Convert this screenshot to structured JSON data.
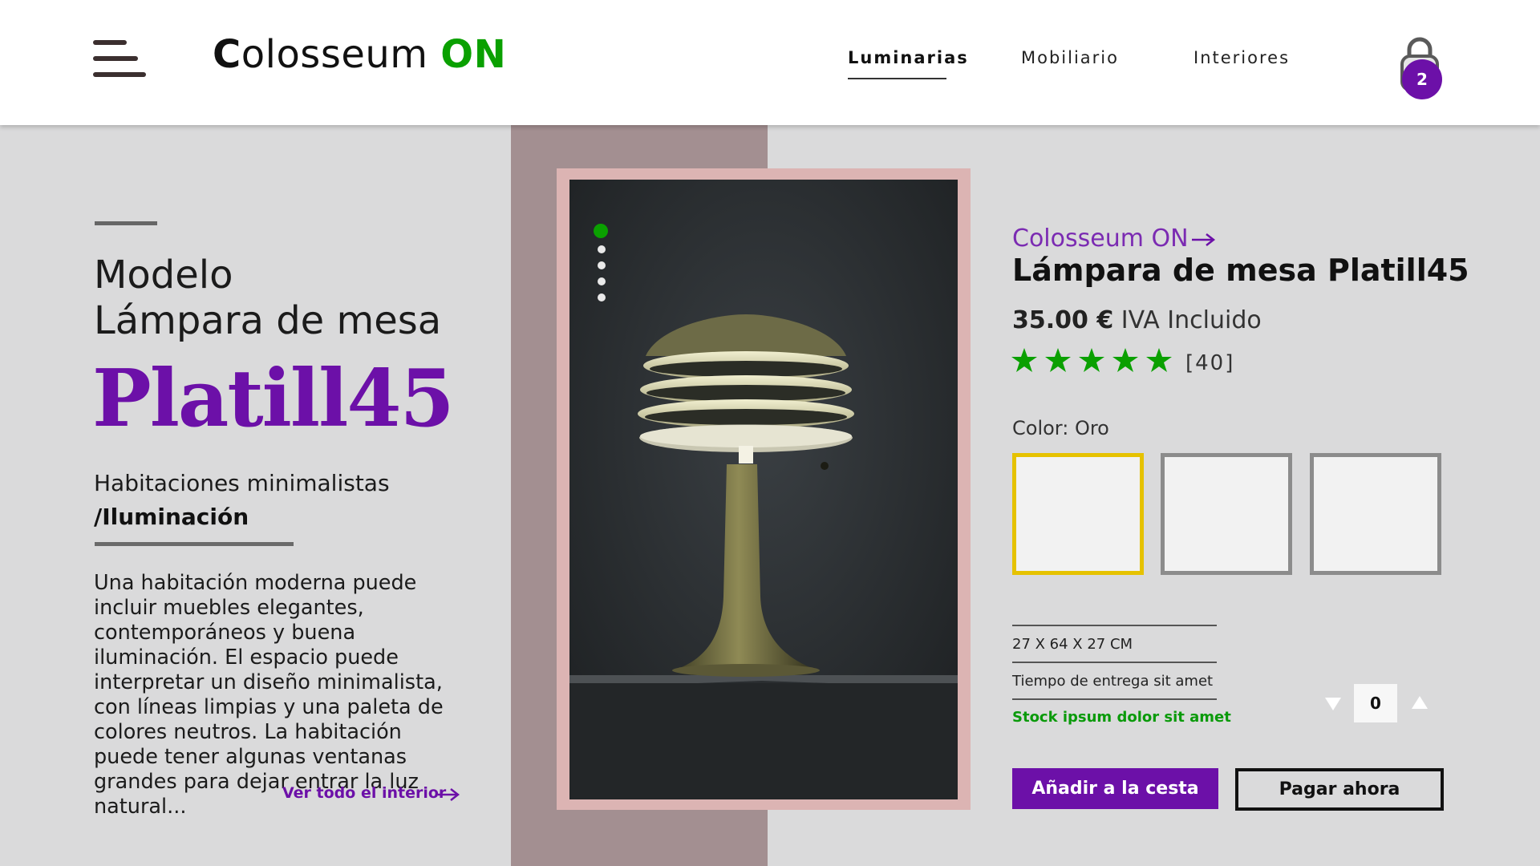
{
  "header": {
    "logo_initial": "C",
    "logo_text": "olosseum",
    "logo_accent": "ON",
    "nav": [
      {
        "label": "Luminarias",
        "active": true
      },
      {
        "label": "Mobiliario",
        "active": false
      },
      {
        "label": "Interiores",
        "active": false
      }
    ],
    "cart_count": "2"
  },
  "hero": {
    "model_line1": "Modelo",
    "model_line2": "Lámpara de mesa",
    "product_name": "Platill45",
    "subtitle": "Habitaciones minimalistas",
    "category": "/Iluminación",
    "description": "Una habitación moderna puede incluir muebles elegantes, contemporáneos y buena iluminación. El espacio puede interpretar un diseño minimalista, con líneas limpias y una paleta de colores neutros. La habitación puede tener algunas ventanas grandes para dejar entrar la luz natural...",
    "see_all_link": "Ver todo el interior"
  },
  "gallery": {
    "slide_count": 5,
    "active_slide": 1
  },
  "product": {
    "brand_link": "Colosseum ON",
    "title": "Lámpara de mesa Platill45",
    "price": "35.00 €",
    "tax_note": "IVA Incluido",
    "rating": 5,
    "reviews": "[40]",
    "color_label": "Color: Oro",
    "swatches": [
      {
        "name": "Oro",
        "selected": true
      },
      {
        "name": "",
        "selected": false
      },
      {
        "name": "",
        "selected": false
      }
    ],
    "dimensions": "27 X 64 X 27 CM",
    "delivery": "Tiempo de entrega sit amet",
    "stock": "Stock ipsum dolor sit amet",
    "quantity": "0",
    "add_to_cart": "Añadir a la cesta",
    "pay_now": "Pagar ahora"
  },
  "colors": {
    "accent": "#6c10a8",
    "brand_green": "#0aa000",
    "star_green": "#0aa000",
    "selected_swatch_border": "#e6c200",
    "background": "#dadadb"
  }
}
